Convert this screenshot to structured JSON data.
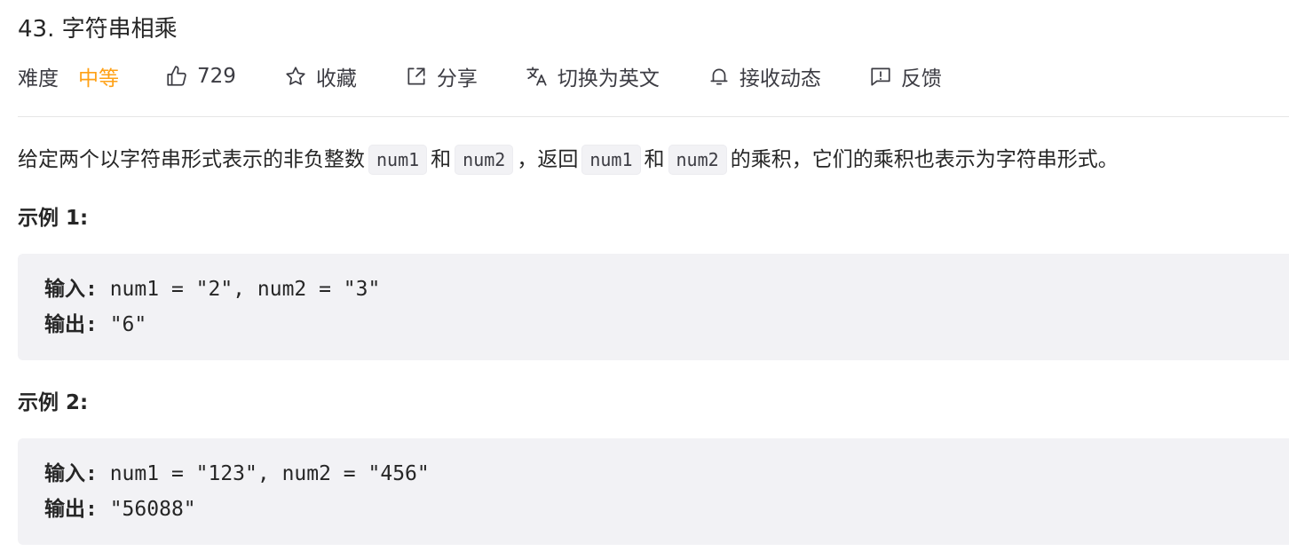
{
  "problem": {
    "title": "43. 字符串相乘"
  },
  "toolbar": {
    "difficulty_label": "难度",
    "difficulty_value": "中等",
    "difficulty_color": "#ffa116",
    "likes_count": "729",
    "favorite_label": "收藏",
    "share_label": "分享",
    "translate_label": "切换为英文",
    "subscribe_label": "接收动态",
    "feedback_label": "反馈",
    "icons": [
      "thumbs-up-icon",
      "star-icon",
      "share-icon",
      "translate-icon",
      "bell-icon",
      "feedback-icon"
    ]
  },
  "description": {
    "part1": "给定两个以字符串形式表示的非负整数",
    "code1": "num1",
    "part2": "和",
    "code2": "num2",
    "part3": "，返回",
    "code3": "num1",
    "part4": "和",
    "code4": "num2",
    "part5": "的乘积，它们的乘积也表示为字符串形式。"
  },
  "examples": [
    {
      "title": "示例 1:",
      "input_label": "输入:",
      "input_value": " num1 = \"2\", num2 = \"3\"",
      "output_label": "输出:",
      "output_value": " \"6\""
    },
    {
      "title": "示例 2:",
      "input_label": "输入:",
      "input_value": " num1 = \"123\", num2 = \"456\"",
      "output_label": "输出:",
      "output_value": " \"56088\""
    }
  ]
}
